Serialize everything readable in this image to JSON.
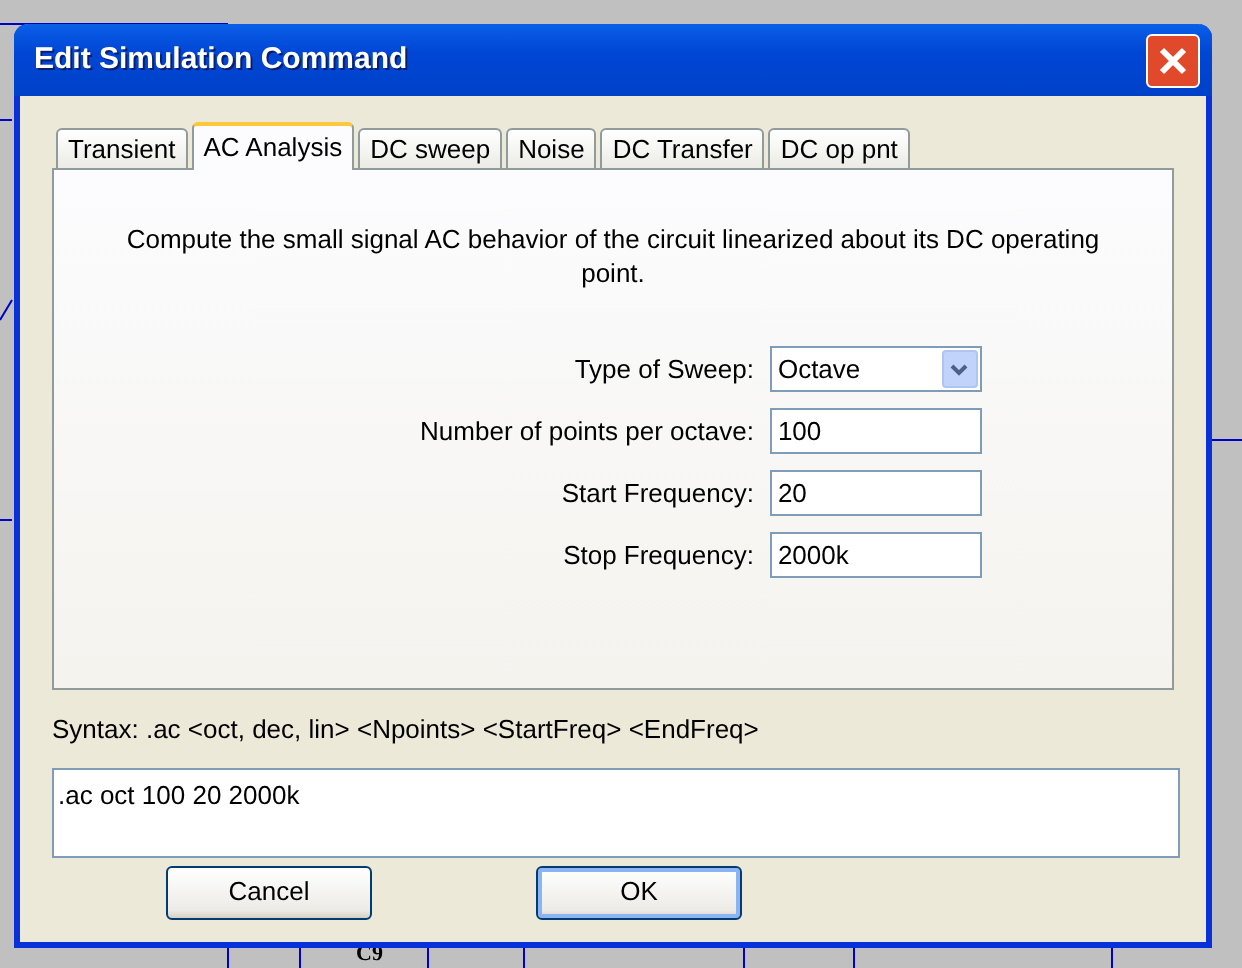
{
  "background": {
    "component_label": "C9"
  },
  "dialog": {
    "title": "Edit Simulation Command",
    "tabs": [
      {
        "label": "Transient",
        "selected": false
      },
      {
        "label": "AC Analysis",
        "selected": true
      },
      {
        "label": "DC sweep",
        "selected": false
      },
      {
        "label": "Noise",
        "selected": false
      },
      {
        "label": "DC Transfer",
        "selected": false
      },
      {
        "label": "DC op pnt",
        "selected": false
      }
    ],
    "description": "Compute the small signal AC behavior of the circuit linearized about its DC operating point.",
    "fields": [
      {
        "kind": "dropdown",
        "label": "Type of Sweep:",
        "value": "Octave"
      },
      {
        "kind": "text",
        "label": "Number of points per octave:",
        "value": "100"
      },
      {
        "kind": "text",
        "label": "Start Frequency:",
        "value": "20"
      },
      {
        "kind": "text",
        "label": "Stop Frequency:",
        "value": "2000k"
      }
    ],
    "syntax": "Syntax:  .ac <oct, dec, lin> <Npoints> <StartFreq> <EndFreq>",
    "command": ".ac oct 100 20 2000k",
    "buttons": [
      {
        "label": "Cancel",
        "default": false
      },
      {
        "label": "OK",
        "default": true
      }
    ]
  }
}
